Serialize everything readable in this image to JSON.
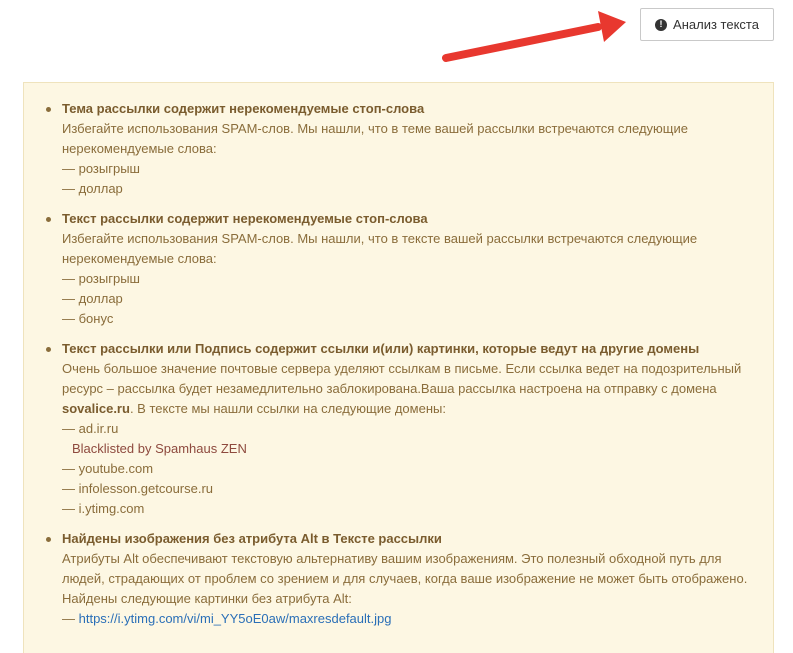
{
  "toolbar": {
    "analyze_label": "Анализ текста"
  },
  "colors": {
    "panel_bg": "#fdf7e3",
    "text": "#8a6d3b",
    "arrow": "#e8382f",
    "link": "#2a6fb7",
    "blacklist_note": "#8e4a3e"
  },
  "warnings": {
    "subject": {
      "title": "Тема рассылки содержит нерекомендуемые стоп-слова",
      "text": "Избегайте использования SPAM-слов. Мы нашли, что в теме вашей рассылки встречаются следующие нерекомендуемые слова:",
      "words": [
        "— розыгрыш",
        "— доллар"
      ]
    },
    "body": {
      "title": "Текст рассылки содержит нерекомендуемые стоп-слова",
      "text": "Избегайте использования SPAM-слов. Мы нашли, что в тексте вашей рассылки встречаются следующие нерекомендуемые слова:",
      "words": [
        "— розыгрыш",
        "— доллар",
        "— бонус"
      ]
    },
    "links": {
      "title": "Текст рассылки или Подпись содержит ссылки и(или) картинки, которые ведут на другие домены",
      "text_before": "Очень большое значение почтовые сервера уделяют ссылкам в письме. Если ссылка ведет на подозрительный ресурс – рассылка будет незамедлительно заблокирована.Ваша рассылка настроена на отправку с домена ",
      "sender_domain": "sovalice.ru",
      "text_after": ". В тексте мы нашли ссылки на следующие домены:",
      "domains": [
        {
          "name": "— ad.ir.ru",
          "note": "Blacklisted by Spamhaus ZEN"
        },
        {
          "name": "— youtube.com",
          "note": ""
        },
        {
          "name": "— infolesson.getcourse.ru",
          "note": ""
        },
        {
          "name": "— i.ytimg.com",
          "note": ""
        }
      ]
    },
    "images": {
      "title": "Найдены изображения без атрибута Alt в Тексте рассылки",
      "text": "Атрибуты Alt обеспечивают текстовую альтернативу вашим изображениям. Это полезный обходной путь для людей, страдающих от проблем со зрением и для случаев, когда ваше изображение не может быть отображено.",
      "found_label": "Найдены следующие картинки без атрибута Alt:",
      "dash": "— ",
      "image_url": "https://i.ytimg.com/vi/mi_YY5oE0aw/maxresdefault.jpg"
    }
  }
}
